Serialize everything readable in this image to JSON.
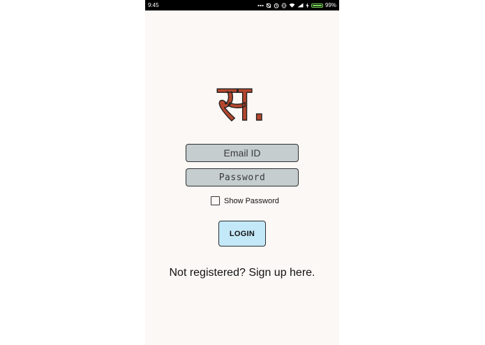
{
  "status_bar": {
    "time": "9:45",
    "battery_text": "99%",
    "battery_level": 0.99,
    "battery_color": "#7bd65a",
    "icons": [
      "more-dots-icon",
      "sync-off-icon",
      "alarm-icon",
      "vibrate-icon",
      "wifi-icon",
      "signal-icon",
      "charging-icon",
      "battery-icon"
    ]
  },
  "logo": {
    "glyph": "स.",
    "color": "#b5472e"
  },
  "form": {
    "email_placeholder": "Email ID",
    "password_placeholder": "Password",
    "show_password_label": "Show Password",
    "show_password_checked": false,
    "login_label": "LOGIN"
  },
  "signup": {
    "text": "Not registered? Sign up here."
  },
  "colors": {
    "background": "#fcf8f5",
    "field_fill": "#c5cdcf",
    "button_fill": "#c3e8f8"
  }
}
